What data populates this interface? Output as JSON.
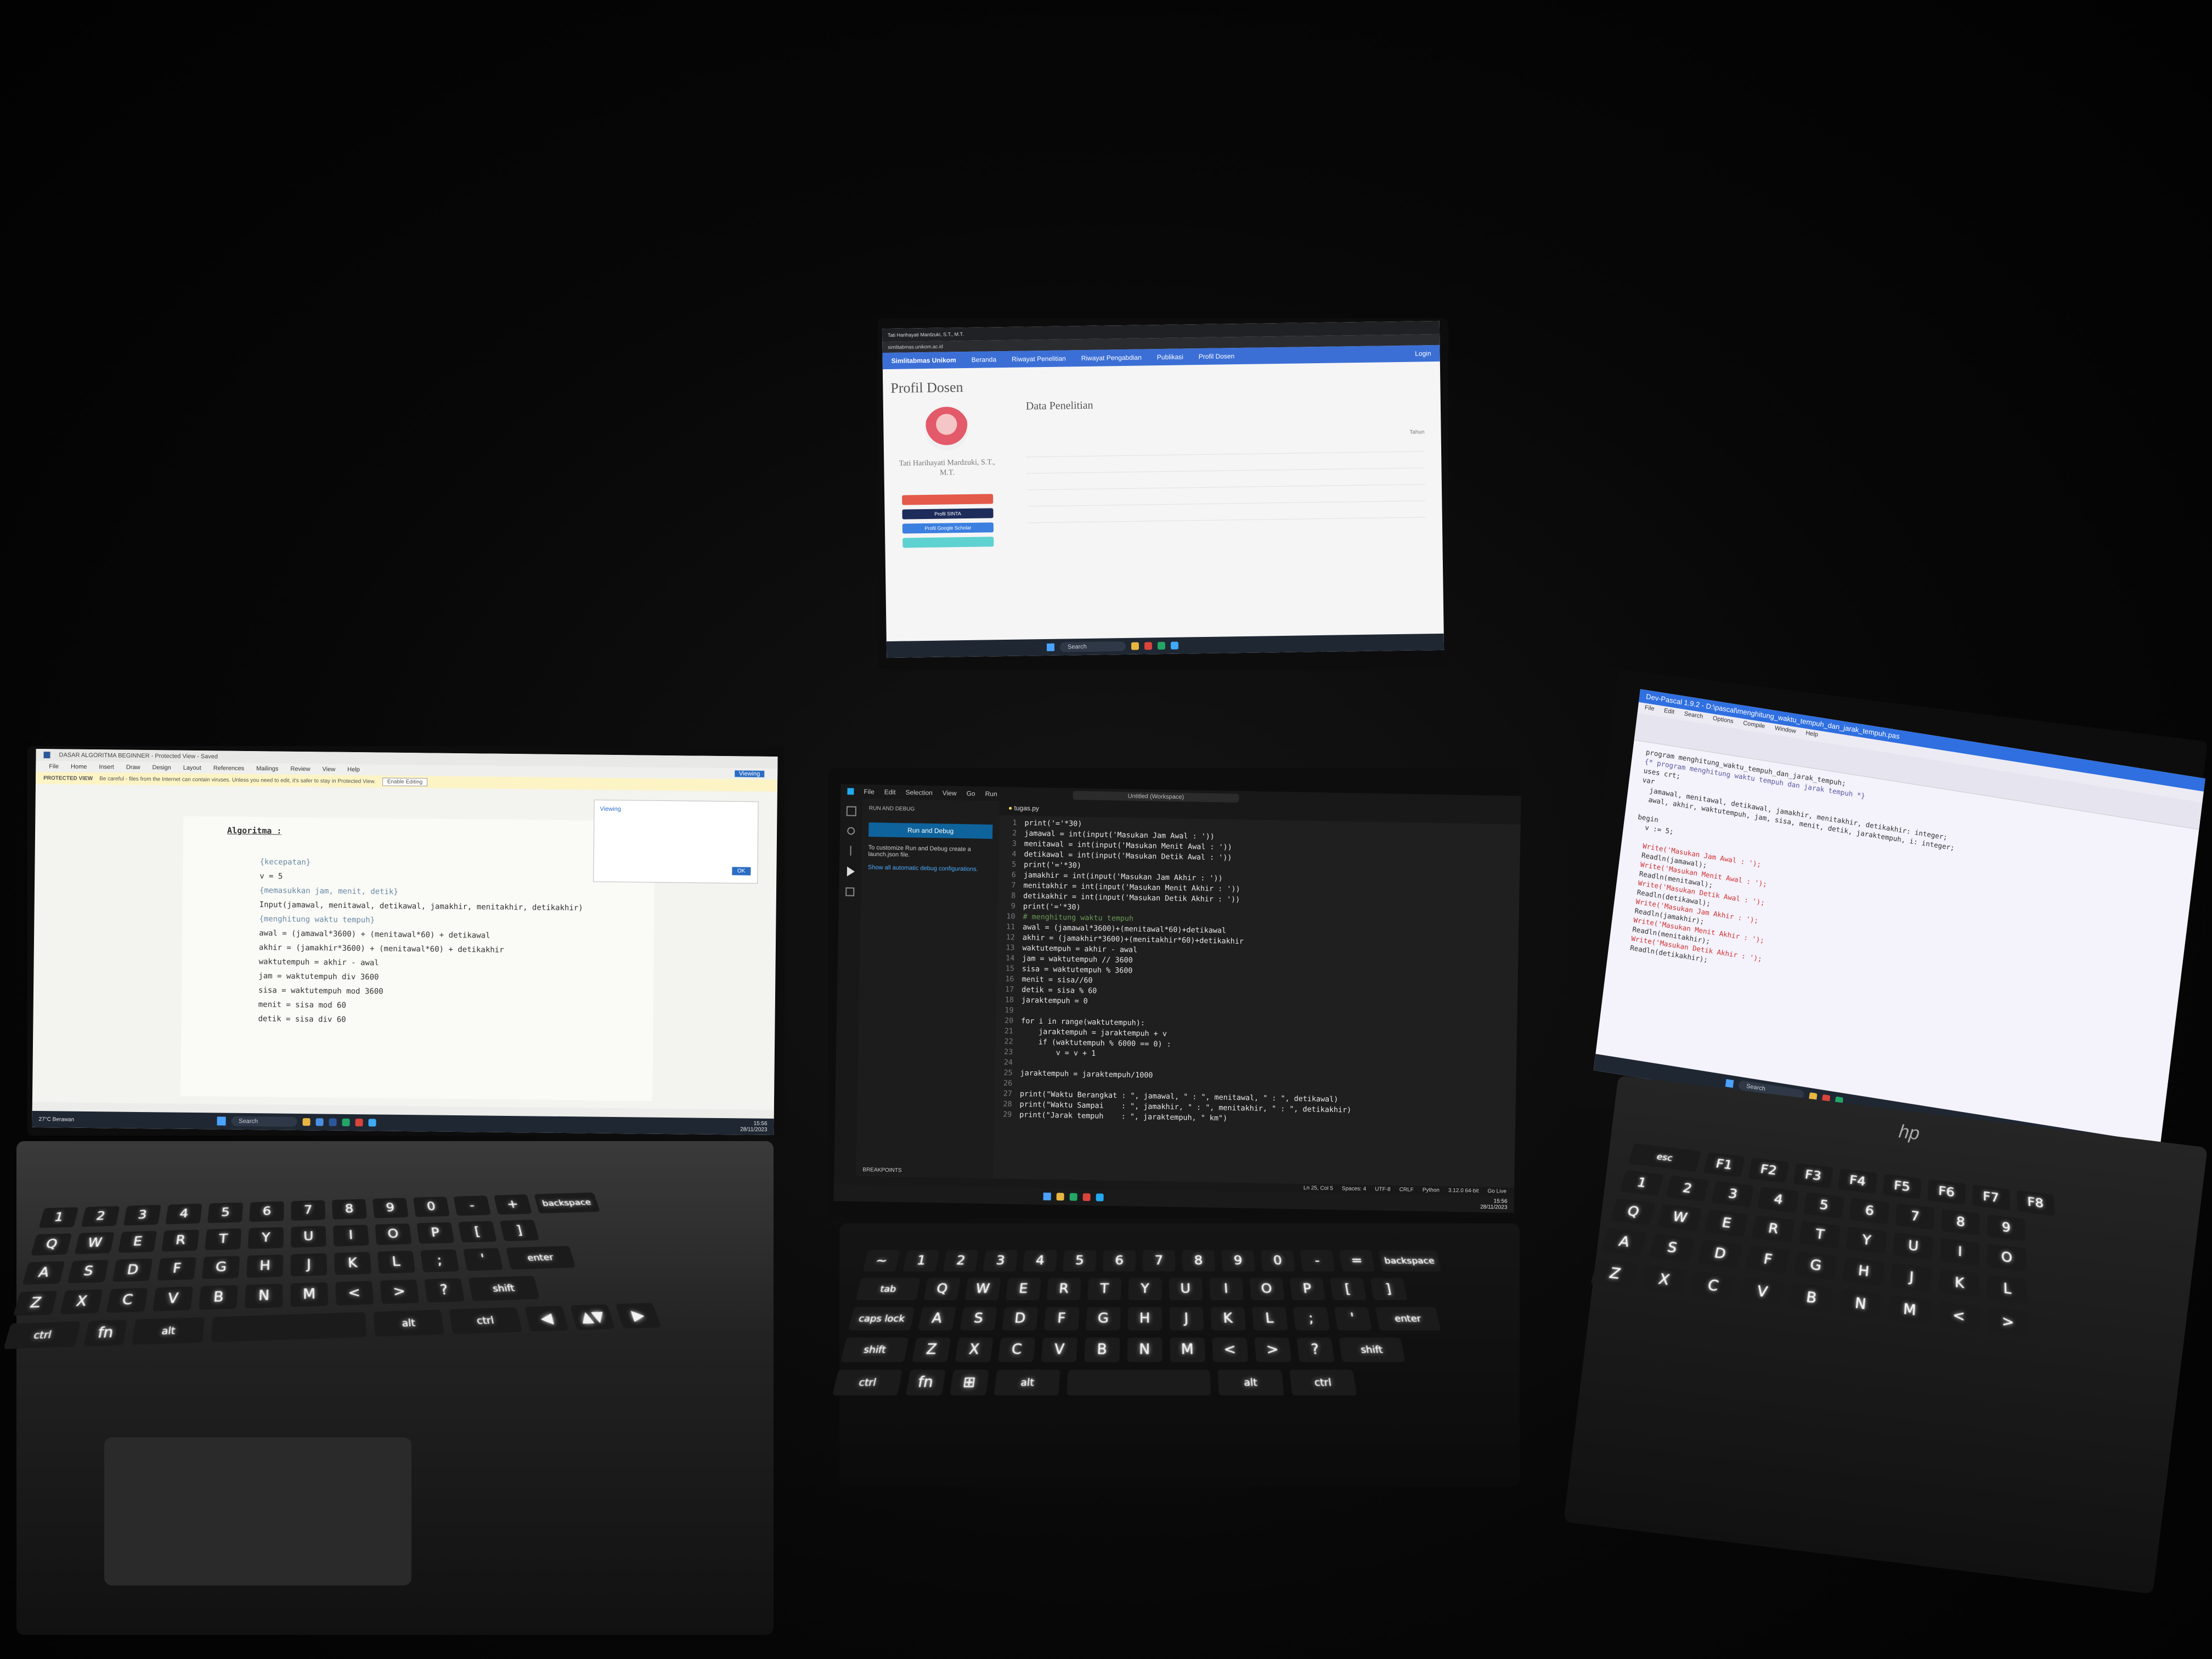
{
  "scene": {
    "description_colors": {
      "background": "#050505",
      "key_glow": "#ffffff",
      "vscode_accent": "#0e639c",
      "browser_nav": "#3b6fd6",
      "pascal_title": "#2f6fe0"
    }
  },
  "word": {
    "title": "DASAR ALGORITMA BEGINNER - Protected View - Saved",
    "menu": [
      "File",
      "Home",
      "Insert",
      "Draw",
      "Design",
      "Layout",
      "References",
      "Mailings",
      "Review",
      "View",
      "Help"
    ],
    "protected_label": "PROTECTED VIEW",
    "protected_msg": "Be careful - files from the Internet can contain viruses. Unless you need to edit, it's safer to stay in Protected View.",
    "enable_editing": "Enable Editing",
    "viewing": "Viewing",
    "popup_title": "Viewing",
    "popup_ok": "OK",
    "doc_heading": "Algoritma :",
    "doc_lines": [
      "{kecepatan}",
      "v = 5",
      "{memasukkan jam, menit, detik}",
      "Input(jamawal, menitawal, detikawal, jamakhir, menitakhir, detikakhir)",
      "{menghitung waktu tempuh}",
      "awal = (jamawal*3600) + (menitawal*60) + detikawal",
      "akhir = (jamakhir*3600) + (menitawal*60) + detikakhir",
      "waktutempuh = akhir - awal",
      "jam = waktutempuh div 3600",
      "sisa = waktutempuh mod 3600",
      "menit = sisa mod 60",
      "detik = sisa div 60"
    ],
    "weather": "27°C Berawan",
    "clock_time": "15:56",
    "clock_date": "28/11/2023",
    "search": "Search"
  },
  "browser": {
    "tab": "Tati Harihayati Mardzuki, S.T., M.T.",
    "url": "simlitabmas.unikom.ac.id",
    "nav_brand": "Simlitabmas Unikom",
    "nav_items": [
      "Beranda",
      "Riwayat Penelitian",
      "Riwayat Pengabdian",
      "Publikasi",
      "Profil Dosen"
    ],
    "login": "Login",
    "profil_heading": "Profil Dosen",
    "name": "Tati Harihayati Mardzuki, S.T., M.T.",
    "buttons": [
      "Profil SINTA",
      "Profil Google Scholar"
    ],
    "section": "Data Penelitian",
    "col_tahun": "Tahun",
    "search": "Search"
  },
  "vscode": {
    "menu": [
      "File",
      "Edit",
      "Selection",
      "View",
      "Go",
      "Run"
    ],
    "command_center": "Untitled (Workspace)",
    "side_title": "RUN AND DEBUG",
    "run_button": "Run and Debug",
    "side_text": "To customize Run and Debug create a launch.json file.",
    "side_link": "Show all automatic debug configurations.",
    "tab": "tugas.py",
    "code": [
      "print('='*30)",
      "jamawal = int(input('Masukan Jam Awal : '))",
      "menitawal = int(input('Masukan Menit Awal : '))",
      "detikawal = int(input('Masukan Detik Awal : '))",
      "print('='*30)",
      "jamakhir = int(input('Masukan Jam Akhir : '))",
      "menitakhir = int(input('Masukan Menit Akhir : '))",
      "detikakhir = int(input('Masukan Detik Akhir : '))",
      "print('='*30)",
      "# menghitung waktu tempuh",
      "awal = (jamawal*3600)+(menitawal*60)+detikawal",
      "akhir = (jamakhir*3600)+(menitakhir*60)+detikakhir",
      "waktutempuh = akhir - awal",
      "jam = waktutempuh // 3600",
      "sisa = waktutempuh % 3600",
      "menit = sisa//60",
      "detik = sisa % 60",
      "jaraktempuh = 0",
      "",
      "for i in range(waktutempuh):",
      "    jaraktempuh = jaraktempuh + v",
      "    if (waktutempuh % 6000 == 0) :",
      "        v = v + 1",
      "",
      "jaraktempuh = jaraktempuh/1000",
      "",
      "print(\"Waktu Berangkat : \", jamawal, \" : \", menitawal, \" : \", detikawal)",
      "print(\"Waktu Sampai    : \", jamakhir, \" : \", menitakhir, \" : \", detikakhir)",
      "print(\"Jarak tempuh    : \", jaraktempuh, \" km\")"
    ],
    "status": [
      "Ln 25, Col 5",
      "Spaces: 4",
      "UTF-8",
      "CRLF",
      "Python",
      "3.12.0 64-bit",
      "Go Live"
    ],
    "breakpoints": "BREAKPOINTS",
    "clock_time": "15:56",
    "clock_date": "28/11/2023"
  },
  "pascal": {
    "title": "Dev-Pascal 1.9.2 - D:\\pascal\\menghitung_waktu_tempuh_dan_jarak_tempuh.pas",
    "menu": [
      "File",
      "Edit",
      "Search",
      "Options",
      "Compile",
      "Window",
      "Help"
    ],
    "code": [
      "program menghitung_waktu_tempuh_dan_jarak_tempuh;",
      "{* program menghitung waktu tempuh dan jarak tempuh *}",
      "uses crt;",
      "var",
      "  jamawal, menitawal, detikawal, jamakhir, menitakhir, detikakhir: integer;",
      "  awal, akhir, waktutempuh, jam, sisa, menit, detik, jaraktempuh, i: integer;",
      "",
      "begin",
      "  v := 5;",
      "",
      "  Write('Masukan Jam Awal : ');",
      "  Readln(jamawal);",
      "  Write('Masukan Menit Awal : ');",
      "  Readln(menitawal);",
      "  Write('Masukan Detik Awal : ');",
      "  Readln(detikawal);",
      "  Write('Masukan Jam Akhir : ');",
      "  Readln(jamakhir);",
      "  Write('Masukan Menit Akhir : ');",
      "  Readln(menitakhir);",
      "  Write('Masukan Detik Akhir : ');",
      "  Readln(detikakhir);"
    ],
    "search": "Search",
    "brand": "hp"
  },
  "keyboards": {
    "left_rows": [
      [
        "1",
        "2",
        "3",
        "4",
        "5",
        "6",
        "7",
        "8",
        "9",
        "0",
        "-",
        "+",
        "backspace"
      ],
      [
        "Q",
        "W",
        "E",
        "R",
        "T",
        "Y",
        "U",
        "I",
        "O",
        "P",
        "[",
        "]"
      ],
      [
        "A",
        "S",
        "D",
        "F",
        "G",
        "H",
        "J",
        "K",
        "L",
        ";",
        "'",
        "enter"
      ],
      [
        "Z",
        "X",
        "C",
        "V",
        "B",
        "N",
        "M",
        "<",
        ">",
        "?",
        "shift"
      ],
      [
        "ctrl",
        "fn",
        "alt",
        "",
        "alt",
        "ctrl",
        "◀",
        "▲▼",
        "▶"
      ]
    ],
    "center_rows": [
      [
        "~",
        "1",
        "2",
        "3",
        "4",
        "5",
        "6",
        "7",
        "8",
        "9",
        "0",
        "-",
        "=",
        "backspace"
      ],
      [
        "tab",
        "Q",
        "W",
        "E",
        "R",
        "T",
        "Y",
        "U",
        "I",
        "O",
        "P",
        "[",
        "]"
      ],
      [
        "caps lock",
        "A",
        "S",
        "D",
        "F",
        "G",
        "H",
        "J",
        "K",
        "L",
        ";",
        "'",
        "enter"
      ],
      [
        "shift",
        "Z",
        "X",
        "C",
        "V",
        "B",
        "N",
        "M",
        "<",
        ">",
        "?",
        "shift"
      ],
      [
        "ctrl",
        "fn",
        "⊞",
        "alt",
        "",
        "alt",
        "ctrl"
      ]
    ],
    "right_rows": [
      [
        "esc",
        "F1",
        "F2",
        "F3",
        "F4",
        "F5",
        "F6",
        "F7",
        "F8"
      ],
      [
        "1",
        "2",
        "3",
        "4",
        "5",
        "6",
        "7",
        "8",
        "9"
      ],
      [
        "Q",
        "W",
        "E",
        "R",
        "T",
        "Y",
        "U",
        "I",
        "O"
      ],
      [
        "A",
        "S",
        "D",
        "F",
        "G",
        "H",
        "J",
        "K",
        "L"
      ],
      [
        "Z",
        "X",
        "C",
        "V",
        "B",
        "N",
        "M",
        "<",
        ">"
      ]
    ]
  }
}
